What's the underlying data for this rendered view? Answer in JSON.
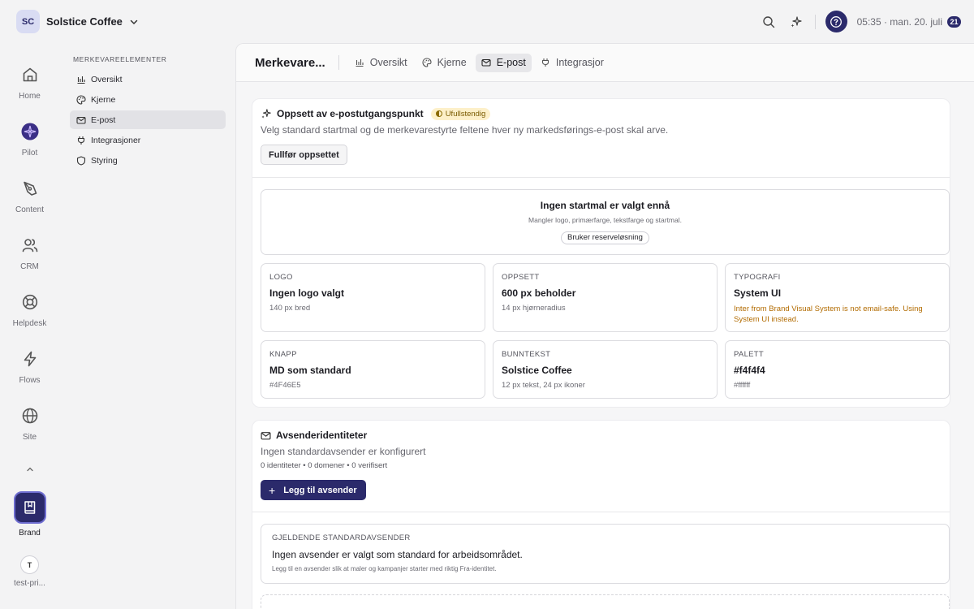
{
  "workspace": {
    "initials": "SC",
    "name": "Solstice Coffee"
  },
  "topbar": {
    "time": "05:35 · man. 20. juli",
    "badge": "21"
  },
  "rail": {
    "items": [
      {
        "label": "Home"
      },
      {
        "label": "Pilot"
      },
      {
        "label": "Content"
      },
      {
        "label": "CRM"
      },
      {
        "label": "Helpdesk"
      },
      {
        "label": "Flows"
      },
      {
        "label": "Site"
      }
    ],
    "brand_label": "Brand",
    "user_initial": "T",
    "user_label": "test-pri..."
  },
  "subnav": {
    "title": "MERKEVAREELEMENTER",
    "items": [
      {
        "label": "Oversikt"
      },
      {
        "label": "Kjerne"
      },
      {
        "label": "E-post"
      },
      {
        "label": "Integrasjoner"
      },
      {
        "label": "Styring"
      }
    ]
  },
  "tabs": {
    "page_title": "Merkevare...",
    "items": [
      {
        "label": "Oversikt"
      },
      {
        "label": "Kjerne"
      },
      {
        "label": "E-post"
      },
      {
        "label": "Integrasjor"
      }
    ]
  },
  "setup": {
    "title": "Oppsett av e-postutgangspunkt",
    "status": "Ufullstendig",
    "description": "Velg standard startmal og de merkevarestyrte feltene hver ny markedsførings-e-post skal arve.",
    "button": "Fullfør oppsettet",
    "empty_title": "Ingen startmal er valgt ennå",
    "empty_sub": "Mangler logo, primærfarge, tekstfarge og startmal.",
    "empty_pill": "Bruker reserveløsning",
    "tiles": [
      {
        "label": "LOGO",
        "value": "Ingen logo valgt",
        "sub": "140 px bred"
      },
      {
        "label": "OPPSETT",
        "value": "600 px beholder",
        "sub": "14 px hjørneradius"
      },
      {
        "label": "TYPOGRAFI",
        "value": "System UI",
        "warning": "Inter from Brand Visual System is not email-safe. Using System UI instead."
      },
      {
        "label": "KNAPP",
        "value": "MD som standard",
        "sub": "#4F46E5"
      },
      {
        "label": "BUNNTEKST",
        "value": "Solstice Coffee",
        "sub": "12 px tekst, 24 px ikoner"
      },
      {
        "label": "PALETT",
        "value": "#f4f4f4",
        "sub": "#ffffff"
      }
    ]
  },
  "senders": {
    "title": "Avsenderidentiteter",
    "description": "Ingen standardavsender er konfigurert",
    "counts": "0 identiteter • 0 domener • 0 verifisert",
    "add_button": "Legg til avsender",
    "default_label": "GJELDENDE STANDARDAVSENDER",
    "default_title": "Ingen avsender er valgt som standard for arbeidsområdet.",
    "default_sub": "Legg til en avsender slik at maler og kampanjer starter med riktig Fra-identitet."
  },
  "colors": {
    "accent": "#2b2a6b",
    "warning_text": "#b26b00",
    "warning_bg": "#fdf0c9"
  }
}
